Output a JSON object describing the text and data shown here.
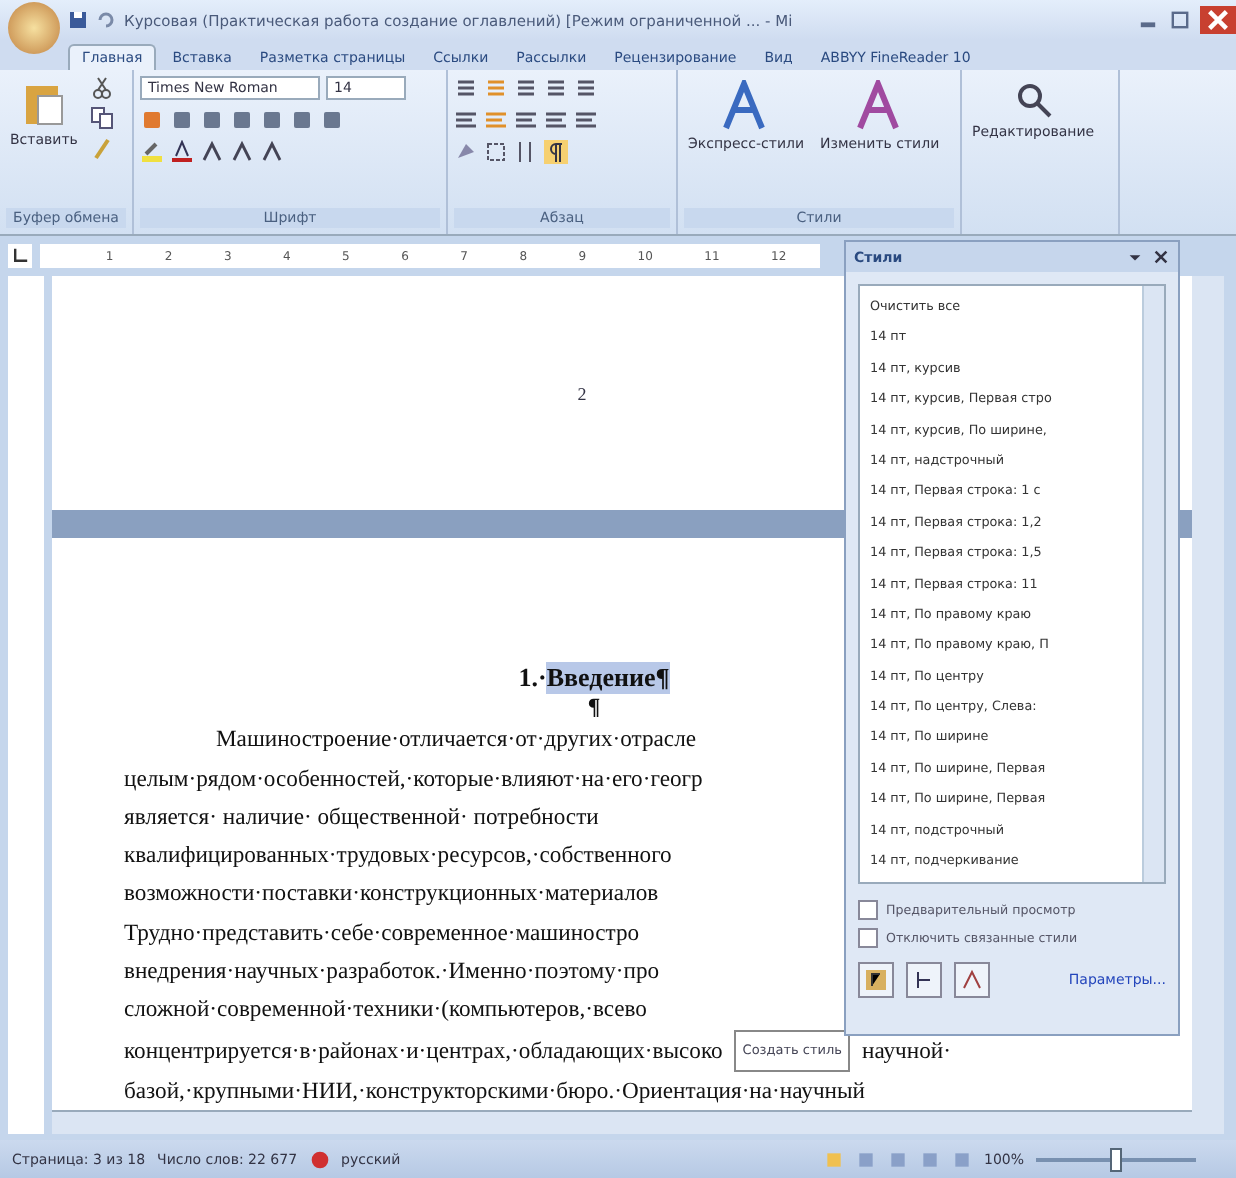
{
  "window": {
    "title": "Курсовая (Практическая работа создание оглавлений) [Режим ограниченной ... - Mi"
  },
  "tabs": [
    {
      "label": "Главная",
      "selected": true
    },
    {
      "label": "Вставка",
      "selected": false
    },
    {
      "label": "Разметка страницы",
      "selected": false
    },
    {
      "label": "Ссылки",
      "selected": false
    },
    {
      "label": "Рассылки",
      "selected": false
    },
    {
      "label": "Рецензирование",
      "selected": false
    },
    {
      "label": "Вид",
      "selected": false
    },
    {
      "label": "ABBYY FineReader 10",
      "selected": false
    }
  ],
  "ribbon": {
    "paste": "Вставить",
    "clipboard_label": "Буфер обмена",
    "font_name": "Times New Roman",
    "font_size": "14",
    "font_label": "Шрифт",
    "paragraph_label": "Абзац",
    "quick_styles": "Экспресс-стили",
    "change_styles": "Изменить стили",
    "styles_label": "Стили",
    "editing": "Редактирование"
  },
  "ruler": [
    "1",
    "2",
    "3",
    "4",
    "5",
    "6",
    "7",
    "8",
    "9",
    "10",
    "11",
    "12"
  ],
  "document": {
    "page_number": "2",
    "heading_number": "1.·",
    "heading_title": "Введение¶",
    "heading_selected": true,
    "pilcrow": "¶",
    "lines": [
      {
        "text": "Машиностроение·отличается·от·других·отрасле",
        "kind": "indent"
      },
      {
        "text": "целым·рядом·особенностей,·которые·влияют·на·его·геогр",
        "kind": "plain"
      },
      {
        "text": "является· наличие· общественной· потребности",
        "kind": "plain"
      },
      {
        "text": "квалифицированных·трудовых·ресурсов,·собственного",
        "kind": "plain"
      },
      {
        "text": "возможности·поставки·конструкционных·материалов",
        "kind": "plain"
      },
      {
        "text": "Трудно·представить·себе·современное·машиностро",
        "kind": "plain"
      },
      {
        "text": "внедрения·научных·разработок.·Именно·поэтому·про",
        "kind": "plain"
      },
      {
        "text": "сложной·современной·техники·(компьютеров,·всево",
        "kind": "plain"
      },
      {
        "text": "концентрируется·в·районах·и·центрах,·обладающих·высоко",
        "kind": "wide",
        "tail": "научной·"
      },
      {
        "text": "базой,·крупными·НИИ,·конструкторскими·бюро.·Ориентация·на·научный",
        "kind": "wide"
      }
    ]
  },
  "styles_pane": {
    "title": "Стили",
    "items": [
      "Очистить все",
      "14 пт",
      "14 пт, курсив",
      "14 пт, курсив, Первая стро",
      "14 пт, курсив, По ширине,",
      "14 пт, надстрочный",
      "14 пт, Первая строка:  1 с",
      "14 пт, Первая строка:  1,2",
      "14 пт, Первая строка:  1,5",
      "14 пт, Первая строка:  11",
      "14 пт, По правому краю",
      "14 пт, По правому краю, П",
      "14 пт, По центру",
      "14 пт, По центру, Слева:",
      "14 пт, По ширине",
      "14 пт, По ширине, Первая",
      "14 пт, По ширине, Первая",
      "14 пт, подстрочный",
      "14 пт, подчеркивание"
    ],
    "options": [
      {
        "label": "Предварительный просмотр",
        "checked": false
      },
      {
        "label": "Отключить связанные стили",
        "checked": false
      }
    ],
    "link": "Параметры...",
    "tooltip": "Создать стиль"
  },
  "status_bar": {
    "page": "Страница: 3 из 18",
    "words": "Число слов: 22 677",
    "language": "русский",
    "zoom": "100%",
    "zoom_level": {
      "level": 0.5
    }
  }
}
